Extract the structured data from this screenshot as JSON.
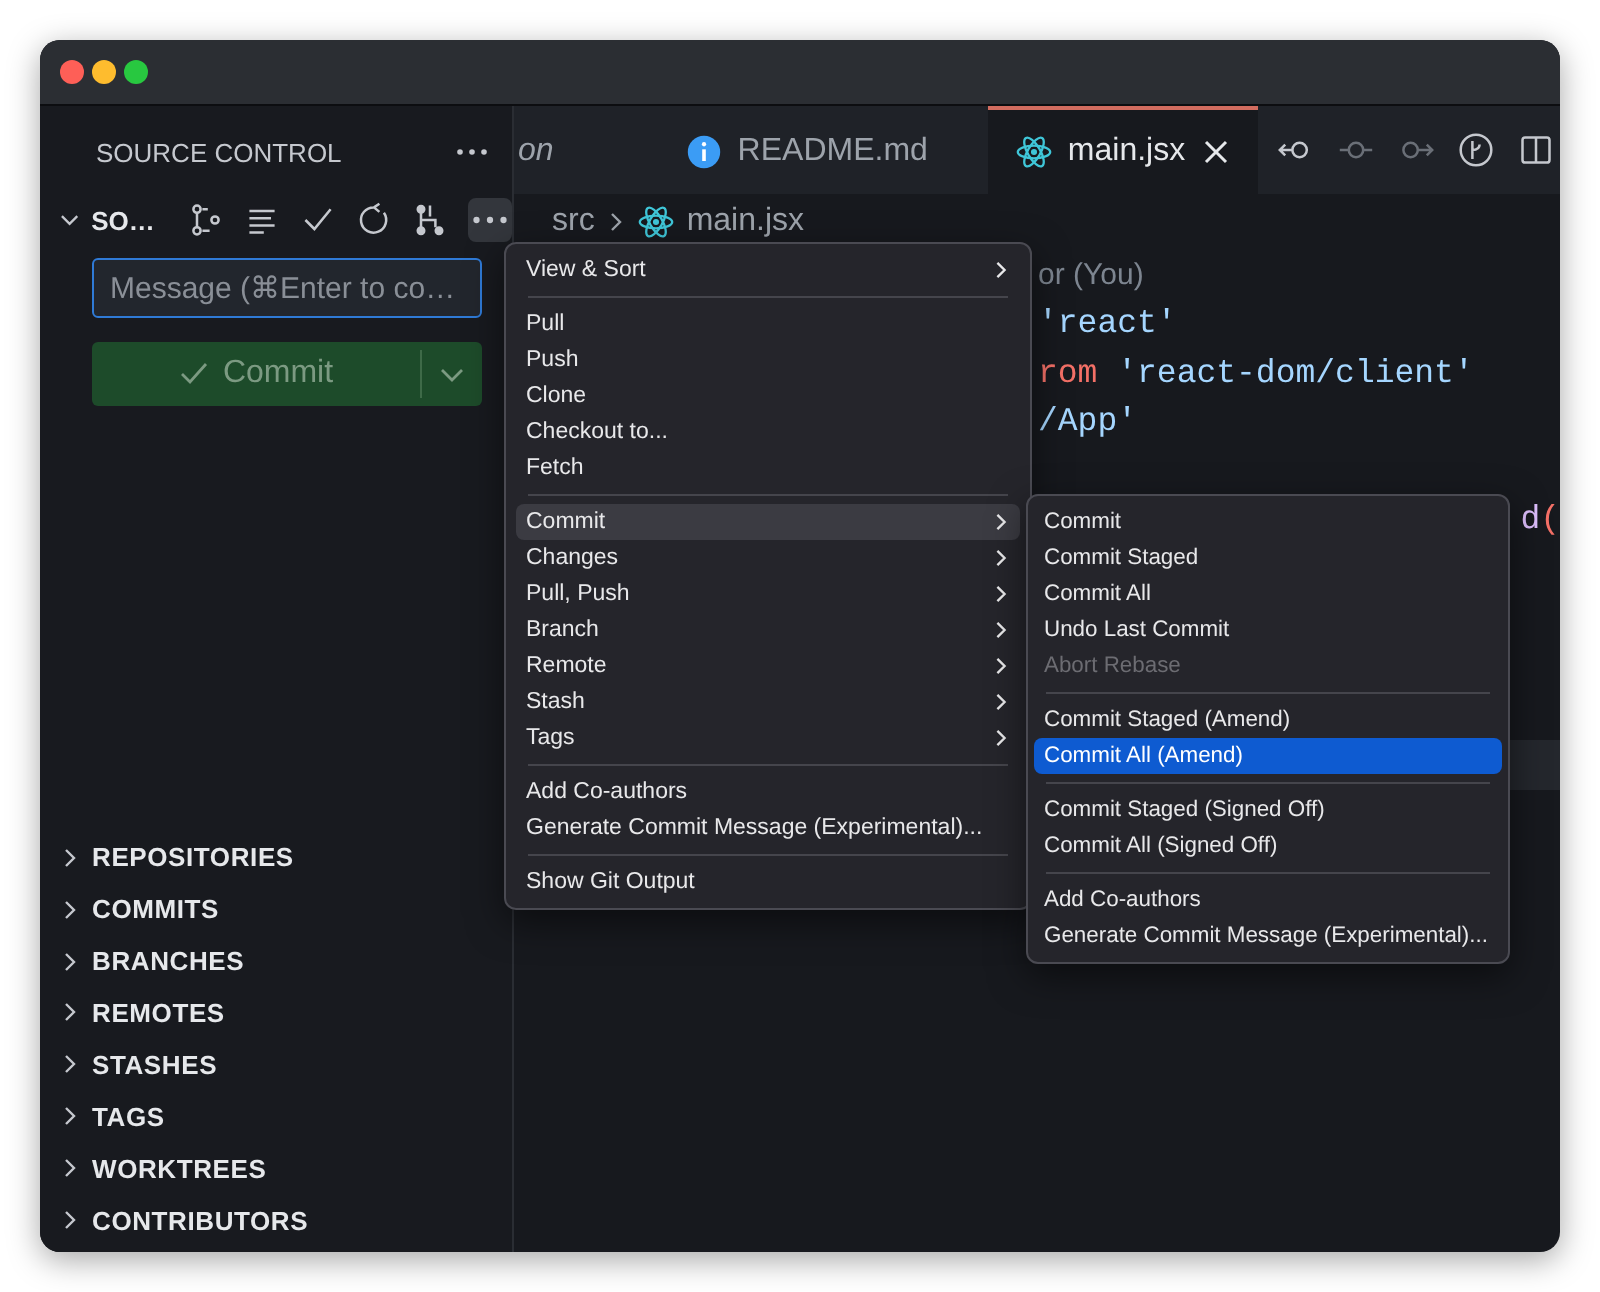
{
  "sidebar": {
    "title": "SOURCE CONTROL",
    "repository": {
      "name": "SO…",
      "expanded": true
    },
    "message_field": {
      "placeholder": "Message (⌘Enter to co…"
    },
    "commit_button": {
      "label": "Commit"
    },
    "sections": [
      {
        "label": "REPOSITORIES",
        "expanded": false
      },
      {
        "label": "COMMITS",
        "expanded": false
      },
      {
        "label": "BRANCHES",
        "expanded": false
      },
      {
        "label": "REMOTES",
        "expanded": false
      },
      {
        "label": "STASHES",
        "expanded": false
      },
      {
        "label": "TAGS",
        "expanded": false
      },
      {
        "label": "WORKTREES",
        "expanded": false
      },
      {
        "label": "CONTRIBUTORS",
        "expanded": false
      }
    ]
  },
  "editor": {
    "tabs": [
      {
        "label": "on",
        "kind": "plain",
        "selected": false
      },
      {
        "label": "README.md",
        "kind": "info",
        "selected": false
      },
      {
        "label": "main.jsx",
        "kind": "react",
        "selected": true
      }
    ],
    "breadcrumb": {
      "folder": "src",
      "file": "main.jsx"
    },
    "lines": [
      {
        "current": false,
        "tokens": [
          {
            "text": "or (You)",
            "kind": "blame"
          }
        ]
      },
      {
        "current": false,
        "tokens": [
          {
            "text": "'react'",
            "kind": "string"
          }
        ]
      },
      {
        "current": false,
        "tokens": [
          {
            "text": "rom",
            "kind": "keyword"
          },
          {
            "text": " 'react-dom/client'",
            "kind": "string"
          }
        ]
      },
      {
        "current": false,
        "tokens": [
          {
            "text": "/App'",
            "kind": "string"
          }
        ]
      },
      {
        "current": false
      },
      {
        "current": false,
        "tokens": [
          {
            "text": "d",
            "kind": "func"
          },
          {
            "text": "(",
            "kind": "paren"
          }
        ]
      },
      {
        "current": false
      },
      {
        "current": false
      },
      {
        "current": false
      },
      {
        "current": false
      },
      {
        "current": true
      }
    ]
  },
  "context_menu": {
    "groups": [
      [
        {
          "label": "View & Sort",
          "submenu": true,
          "expanded": false
        }
      ],
      [
        {
          "label": "Pull",
          "submenu": false,
          "expanded": false
        },
        {
          "label": "Push",
          "submenu": false,
          "expanded": false
        },
        {
          "label": "Clone",
          "submenu": false,
          "expanded": false
        },
        {
          "label": "Checkout to...",
          "submenu": false,
          "expanded": false
        },
        {
          "label": "Fetch",
          "submenu": false,
          "expanded": false
        }
      ],
      [
        {
          "label": "Commit",
          "submenu": true,
          "expanded": true
        },
        {
          "label": "Changes",
          "submenu": true,
          "expanded": false
        },
        {
          "label": "Pull, Push",
          "submenu": true,
          "expanded": false
        },
        {
          "label": "Branch",
          "submenu": true,
          "expanded": false
        },
        {
          "label": "Remote",
          "submenu": true,
          "expanded": false
        },
        {
          "label": "Stash",
          "submenu": true,
          "expanded": false
        },
        {
          "label": "Tags",
          "submenu": true,
          "expanded": false
        }
      ],
      [
        {
          "label": "Add Co-authors",
          "submenu": false,
          "expanded": false
        },
        {
          "label": "Generate Commit Message (Experimental)...",
          "submenu": false,
          "expanded": false
        }
      ],
      [
        {
          "label": "Show Git Output",
          "submenu": false,
          "expanded": false
        }
      ]
    ]
  },
  "submenu": {
    "groups": [
      [
        {
          "label": "Commit",
          "selected": false,
          "disabled": false
        },
        {
          "label": "Commit Staged",
          "selected": false,
          "disabled": false
        },
        {
          "label": "Commit All",
          "selected": false,
          "disabled": false
        },
        {
          "label": "Undo Last Commit",
          "selected": false,
          "disabled": false
        },
        {
          "label": "Abort Rebase",
          "selected": false,
          "disabled": true
        }
      ],
      [
        {
          "label": "Commit Staged (Amend)",
          "selected": false,
          "disabled": false
        },
        {
          "label": "Commit All (Amend)",
          "selected": true,
          "disabled": false
        }
      ],
      [
        {
          "label": "Commit Staged (Signed Off)",
          "selected": false,
          "disabled": false
        },
        {
          "label": "Commit All (Signed Off)",
          "selected": false,
          "disabled": false
        }
      ],
      [
        {
          "label": "Add Co-authors",
          "selected": false,
          "disabled": false
        },
        {
          "label": "Generate Commit Message (Experimental)...",
          "selected": false,
          "disabled": false
        }
      ]
    ]
  }
}
